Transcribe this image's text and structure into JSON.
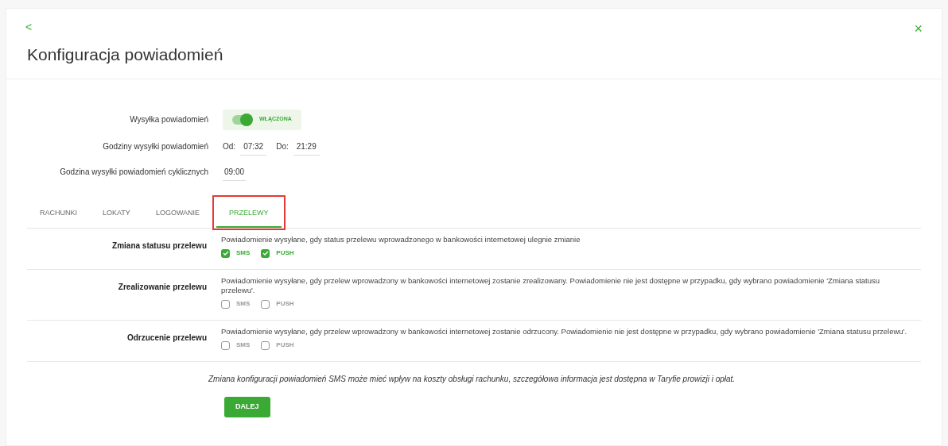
{
  "header": {
    "back": "<",
    "close": "×",
    "title": "Konfiguracja powiadomień"
  },
  "settings": {
    "sending": {
      "label": "Wysyłka powiadomień",
      "on": true,
      "state_text": "WŁĄCZONA"
    },
    "hours": {
      "label": "Godziny wysyłki powiadomień",
      "from_label": "Od:",
      "from": "07:32",
      "to_label": "Do:",
      "to": "21:29"
    },
    "cyclic": {
      "label": "Godzina wysyłki powiadomień cyklicznych",
      "value": "09:00"
    }
  },
  "tabs": [
    {
      "label": "RACHUNKI",
      "selected": false,
      "highlighted": false
    },
    {
      "label": "LOKATY",
      "selected": false,
      "highlighted": false
    },
    {
      "label": "LOGOWANIE",
      "selected": false,
      "highlighted": false
    },
    {
      "label": "PRZELEWY",
      "selected": true,
      "highlighted": true
    }
  ],
  "rows": [
    {
      "title": "Zmiana statusu przelewu",
      "description": "Powiadomienie wysyłane, gdy status przelewu wprowadzonego w bankowości internetowej ulegnie zmianie",
      "options": [
        {
          "label": "SMS",
          "checked": true
        },
        {
          "label": "PUSH",
          "checked": true
        }
      ]
    },
    {
      "title": "Zrealizowanie przelewu",
      "description": "Powiadomienie wysyłane, gdy przelew wprowadzony w bankowości internetowej zostanie zrealizowany. Powiadomienie nie jest dostępne w przypadku, gdy wybrano powiadomienie 'Zmiana statusu przelewu'.",
      "options": [
        {
          "label": "SMS",
          "checked": false
        },
        {
          "label": "PUSH",
          "checked": false
        }
      ]
    },
    {
      "title": "Odrzucenie przelewu",
      "description": "Powiadomienie wysyłane, gdy przelew wprowadzony w bankowości internetowej zostanie odrzucony. Powiadomienie nie jest dostępne w przypadku, gdy wybrano powiadomienie 'Zmiana statusu przelewu'.",
      "options": [
        {
          "label": "SMS",
          "checked": false
        },
        {
          "label": "PUSH",
          "checked": false
        }
      ]
    }
  ],
  "note": "Zmiana konfiguracji powiadomień SMS może mieć wpływ na koszty obsługi rachunku, szczegółowa informacja jest dostępna w Taryfie prowizji i opłat.",
  "next_button": "DALEJ"
}
